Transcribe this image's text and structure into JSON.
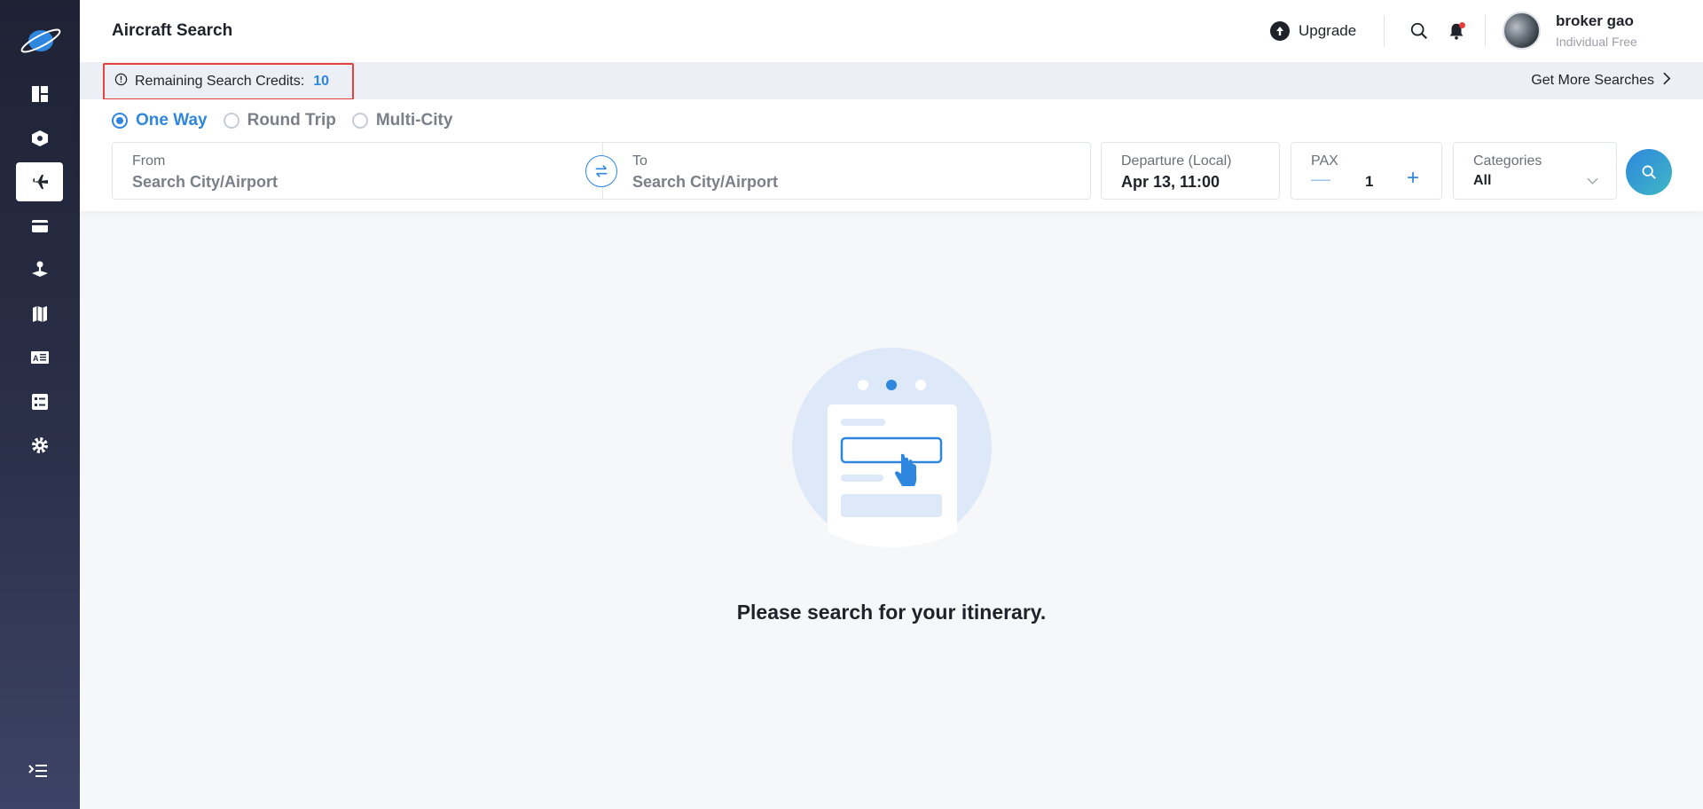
{
  "sidebar": {
    "items": [
      {
        "name": "dashboard-icon",
        "active": false
      },
      {
        "name": "cube-icon",
        "active": false
      },
      {
        "name": "airplane-icon",
        "active": true
      },
      {
        "name": "card-icon",
        "active": false
      },
      {
        "name": "joystick-icon",
        "active": false
      },
      {
        "name": "map-icon",
        "active": false
      },
      {
        "name": "dictionary-icon",
        "active": false
      },
      {
        "name": "checklist-icon",
        "active": false
      },
      {
        "name": "gear-icon",
        "active": false
      }
    ],
    "collapse_icon": "collapse-menu-icon"
  },
  "header": {
    "title": "Aircraft Search",
    "upgrade_label": "Upgrade",
    "user_name": "broker gao",
    "user_plan": "Individual Free"
  },
  "credits": {
    "label": "Remaining Search Credits:",
    "value": "10",
    "get_more_label": "Get More Searches"
  },
  "search": {
    "trip_types": [
      "One Way",
      "Round Trip",
      "Multi-City"
    ],
    "selected_trip": "One Way",
    "from_label": "From",
    "from_placeholder": "Search City/Airport",
    "to_label": "To",
    "to_placeholder": "Search City/Airport",
    "departure_label": "Departure (Local)",
    "departure_value": "Apr 13, 11:00",
    "pax_label": "PAX",
    "pax_minus": "—",
    "pax_value": "1",
    "pax_plus": "+",
    "categories_label": "Categories",
    "categories_value": "All"
  },
  "empty_state": {
    "message": "Please search for your itinerary."
  },
  "colors": {
    "accent": "#2e86de",
    "sidebar_top": "#1e2235",
    "sidebar_bottom": "#3d4366",
    "highlight_border": "#e0443a"
  }
}
